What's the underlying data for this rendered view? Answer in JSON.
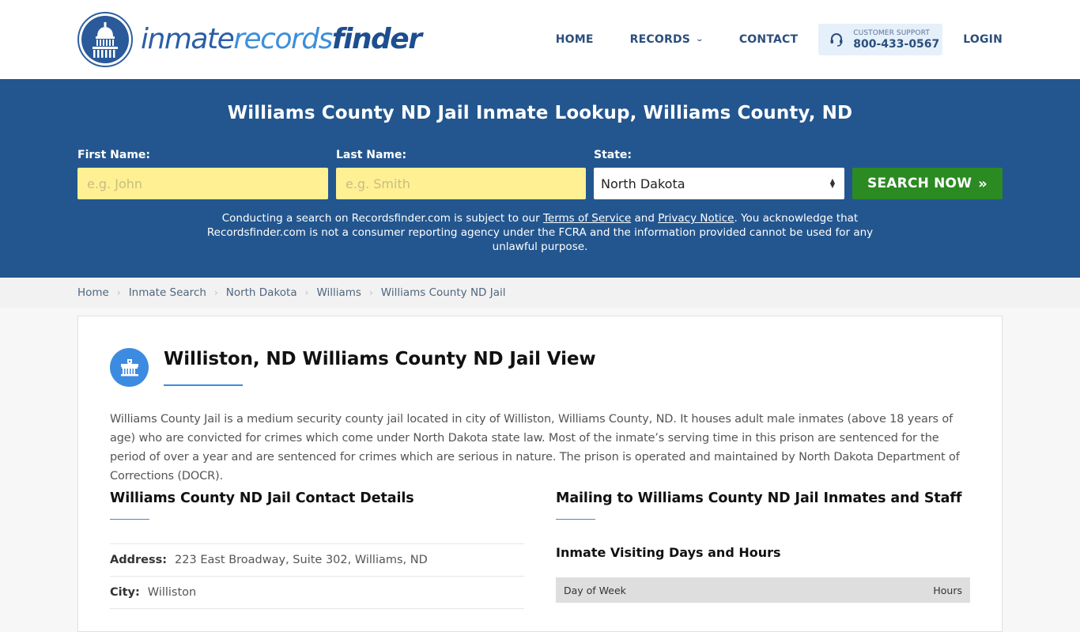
{
  "header": {
    "logo": {
      "part1": "inmate",
      "part2": "records",
      "part3": "finder"
    },
    "nav": [
      {
        "label": "HOME"
      },
      {
        "label": "RECORDS",
        "has_dropdown": true
      },
      {
        "label": "CONTACT"
      }
    ],
    "support": {
      "label": "CUSTOMER SUPPORT",
      "phone": "800-433-0567",
      "icon": "headset-icon"
    },
    "login_label": "LOGIN"
  },
  "search": {
    "title": "Williams County ND Jail Inmate Lookup, Williams County, ND",
    "first_name": {
      "label": "First Name:",
      "placeholder": "e.g. John",
      "value": ""
    },
    "last_name": {
      "label": "Last Name:",
      "placeholder": "e.g. Smith",
      "value": ""
    },
    "state": {
      "label": "State:",
      "selected": "North Dakota"
    },
    "button_label": "SEARCH NOW",
    "button_icon": "»",
    "disclaimer": {
      "part1": "Conducting a search on Recordsfinder.com is subject to our ",
      "terms_link": "Terms of Service",
      "part2": " and ",
      "privacy_link": "Privacy Notice",
      "part3": ". You acknowledge that Recordsfinder.com is not a consumer reporting agency under the FCRA and the information provided cannot be used for any unlawful purpose."
    }
  },
  "breadcrumb": [
    {
      "label": "Home"
    },
    {
      "label": "Inmate Search"
    },
    {
      "label": "North Dakota"
    },
    {
      "label": "Williams"
    },
    {
      "label": "Williams County ND Jail"
    }
  ],
  "main": {
    "icon": "jail-building-icon",
    "title": "Williston, ND Williams County ND Jail View",
    "intro": "Williams County Jail is a medium security county jail located in city of Williston, Williams County, ND. It houses adult male inmates (above 18 years of age) who are convicted for crimes which come under North Dakota state law. Most of the inmate’s serving time in this prison are sentenced for the period of over a year and are sentenced for crimes which are serious in nature. The prison is operated and maintained by North Dakota Department of Corrections (DOCR).",
    "contact": {
      "heading": "Williams County ND Jail Contact Details",
      "rows": [
        {
          "key": "Address:",
          "value": "223 East Broadway, Suite 302, Williams, ND"
        },
        {
          "key": "City:",
          "value": "Williston"
        }
      ]
    },
    "mailing": {
      "heading": "Mailing to Williams County ND Jail Inmates and Staff",
      "visiting_heading": "Inmate Visiting Days and Hours",
      "table_headers": [
        "Day of Week",
        "Hours"
      ]
    }
  },
  "colors": {
    "brand_blue": "#23568f",
    "accent_blue": "#3d8be0",
    "input_yellow": "#fff094",
    "search_green": "#2b8a22",
    "nav_text": "#2c4f7c"
  }
}
